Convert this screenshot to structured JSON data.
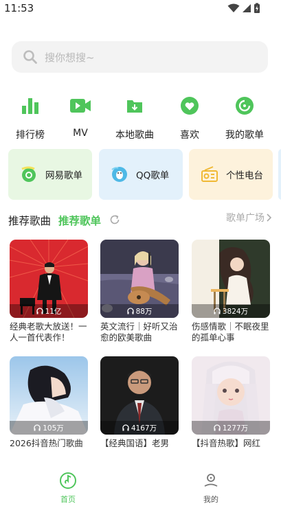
{
  "status_bar": {
    "time": "11:53"
  },
  "search": {
    "placeholder": "搜你想搜~"
  },
  "quick_nav": [
    {
      "label": "排行榜",
      "icon": "bar-chart-icon"
    },
    {
      "label": "MV",
      "icon": "video-camera-icon"
    },
    {
      "label": "本地歌曲",
      "icon": "folder-download-icon"
    },
    {
      "label": "喜欢",
      "icon": "heart-icon"
    },
    {
      "label": "我的歌单",
      "icon": "disc-icon"
    }
  ],
  "cards": [
    {
      "label": "网易歌单",
      "icon": "netease-icon",
      "bg": "#e8f7e3"
    },
    {
      "label": "QQ歌单",
      "icon": "qq-penguin-icon",
      "bg": "#e3f1fb"
    },
    {
      "label": "个性电台",
      "icon": "radio-icon",
      "bg": "#fdf2dc"
    }
  ],
  "section": {
    "tab_songs": "推荐歌曲",
    "tab_playlists": "推荐歌单",
    "square_link": "歌单广场"
  },
  "playlists": [
    {
      "count": "11亿",
      "title": "经典老歌大放送！一人一首代表作！"
    },
    {
      "count": "88万",
      "title": "英文流行｜好听又治愈的欧美歌曲"
    },
    {
      "count": "3824万",
      "title": "伤感情歌｜不眠夜里的孤单心事"
    },
    {
      "count": "105万",
      "title": "2026抖音热门歌曲"
    },
    {
      "count": "4167万",
      "title": "【经典国语】老男"
    },
    {
      "count": "1277万",
      "title": "【抖音热歌】网红"
    }
  ],
  "bottom_nav": [
    {
      "label": "首页",
      "icon": "home-disc-icon"
    },
    {
      "label": "我的",
      "icon": "profile-icon"
    }
  ],
  "colors": {
    "accent": "#4fc55b",
    "inactive": "#555555"
  }
}
